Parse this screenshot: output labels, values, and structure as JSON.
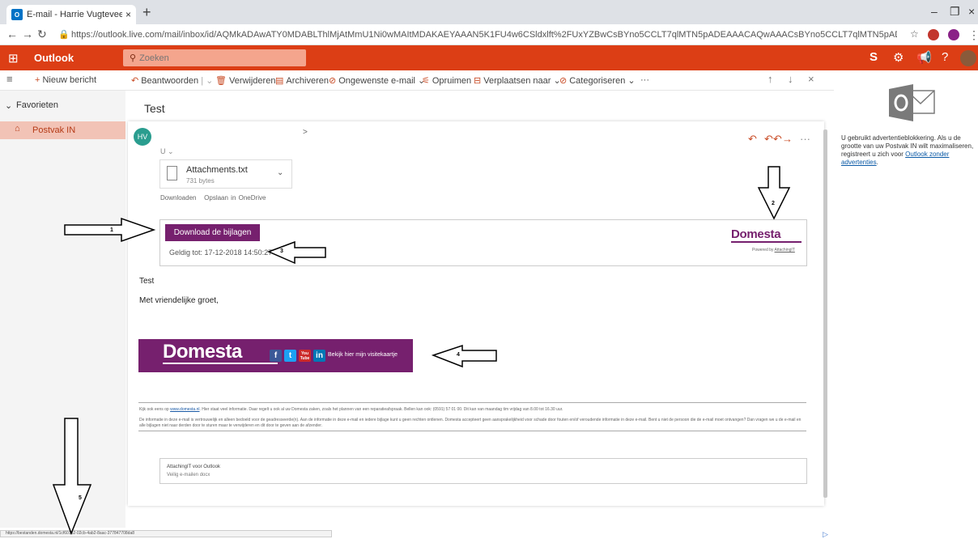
{
  "browser": {
    "tab_title": "E-mail - Harrie Vugteveen - Outl",
    "tab_favicon": "O",
    "new_tab_label": "+",
    "url": "https://outlook.live.com/mail/inbox/id/AQMkADAwATY0MDABLThlMjAtMmU1Ni0wMAItMDAKAEYAAAN5K1FU4w6CSldxlft%2FUxYZBwCsBYno5CCLT7qlMTN5pADEAAACAQwAAACsBYno5CCLT7qlMTN5pADEAAAI0d%2BICAAAA",
    "status_url": "https://bestanden.domesta.nl/1cf601b2-02cb-4ab2-8aac-377847708da8"
  },
  "header": {
    "brand": "Outlook",
    "search_placeholder": "Zoeken",
    "icons": [
      "skype-icon",
      "settings-icon",
      "megaphone-icon",
      "help-icon",
      "avatar-icon"
    ],
    "accent": "#dc3e15"
  },
  "commandbar": {
    "new_message": "Nieuw bericht",
    "reply": "Beantwoorden",
    "delete": "Verwijderen",
    "archive": "Archiveren",
    "junk": "Ongewenste e-mail",
    "sweep": "Opruimen",
    "move_to": "Verplaatsen naar",
    "categorize": "Categoriseren",
    "more": "···"
  },
  "sidebar": {
    "favorites": "Favorieten",
    "inbox": "Postvak IN"
  },
  "message": {
    "subject": "Test",
    "sender_initials": "HV",
    "to_label": "U",
    "attachment": {
      "name": "Attachments.txt",
      "size": "731 bytes"
    },
    "attachment_actions": [
      "Downloaden",
      "Opslaan in OneDrive"
    ],
    "download_button": "Download de bijlagen",
    "validity": "Geldig tot: 17-12-2018 14:50:27",
    "logo_text": "Domesta",
    "powered_by": "Powered by",
    "powered_by_link": "AttachingIT",
    "body_line1": "Test",
    "greeting": "Met vriendelijke groet,",
    "banner": {
      "logo": "Domesta",
      "social": [
        "f",
        "t",
        "You Tube",
        "in"
      ],
      "visit_card": "Bekijk hier mijn visitekaartje"
    },
    "footer_line1_prefix": "Kijk ook eens op",
    "footer_link": "www.domesta.nl",
    "footer_line1_suffix": ". Hier staat veel informatie. Daar regelt u ook al uw Domesta zaken, zoals het plannen van een reparatieafspraak. Bellen kan ook: (0591) 57 01 00. Dit kan van maandag tim vrijdag van 8.00 tot 16.30 uur.",
    "footer_line2": "De informatie in deze e-mail is vertrouwelijk en alleen bedoeld voor de geadresseerde(n). Aan de informatie in deze e-mail en iedere bijlage kunt u geen rechten ontlenen. Domesta accepteert geen aansprakelijkheid voor schade door fouten en/of veroudende informatie in deze e-mail. Bent u niet de persoon die de e-mail moet ontvangen? Dan vragen we u de e-mail en alle bijlagen niet naar derden door te sturen maar te verwijderen en dit door te geven aan de afzender.",
    "addin_title": "AttachingIT voor Outlook",
    "addin_subtitle": "Veilig e-mailen docx"
  },
  "ad": {
    "text": "U gebruikt advertentieblokkering. Als u de grootte van uw Postvak IN wilt maximaliseren, registreert u zich voor",
    "link": "Outlook zonder advertenties",
    "after_link": "."
  },
  "annotations": [
    "1",
    "2",
    "3",
    "4",
    "5"
  ],
  "colors": {
    "domesta_purple": "#76206e",
    "inbox_selected": "#f2c3b6"
  }
}
